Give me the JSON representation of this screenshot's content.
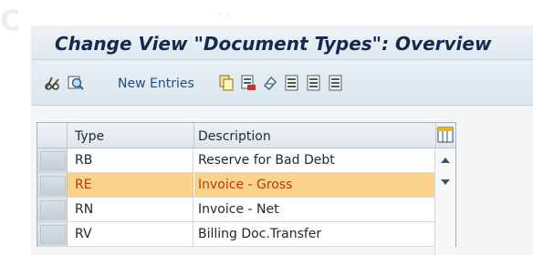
{
  "window": {
    "title": "Change View \"Document Types\": Overview",
    "ghost_letter": "C",
    "ghost_dots": "··"
  },
  "toolbar": {
    "new_entries_label": "New Entries",
    "icons": [
      "edit-display-icon",
      "details-icon",
      "copy-icon",
      "delete-icon",
      "undo-change-icon",
      "select-all-icon",
      "select-block-icon",
      "deselect-all-icon"
    ]
  },
  "table": {
    "columns": [
      "Type",
      "Description"
    ],
    "rows": [
      {
        "type": "RB",
        "description": "Reserve for Bad Debt",
        "selected": false
      },
      {
        "type": "RE",
        "description": "Invoice - Gross",
        "selected": true
      },
      {
        "type": "RN",
        "description": "Invoice - Net",
        "selected": false
      },
      {
        "type": "RV",
        "description": "Billing Doc.Transfer",
        "selected": false
      }
    ]
  },
  "colors": {
    "selected_row_bg": "#fad38b",
    "selected_row_text": "#c1330d",
    "title_text": "#14294d",
    "link_text": "#1a4f8a"
  }
}
